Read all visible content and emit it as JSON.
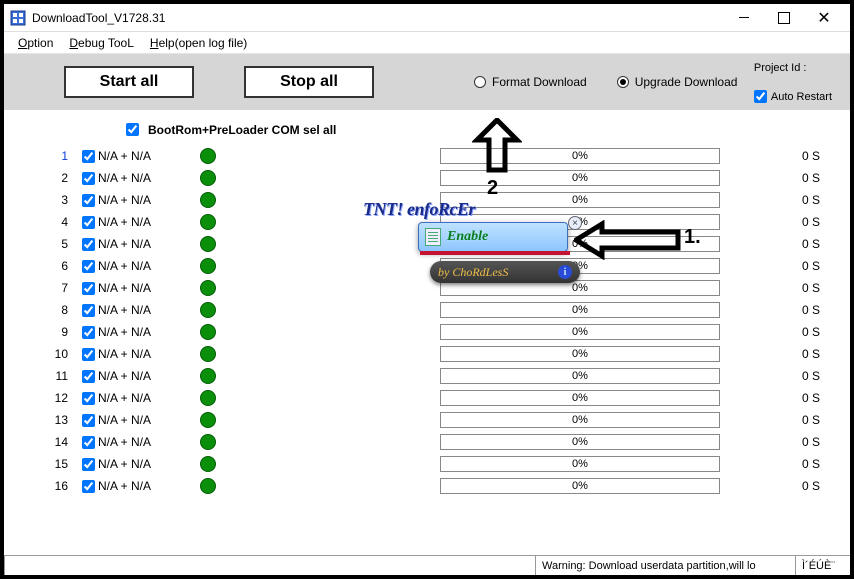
{
  "window": {
    "title": "DownloadTool_V1728.31",
    "minimize": "–",
    "maximize": "□",
    "close": "✕"
  },
  "menu": {
    "option": "Option",
    "debug": "Debug TooL",
    "help": "Help(open log file)"
  },
  "toolbar": {
    "start_all": "Start all",
    "stop_all": "Stop all",
    "format_dl": "Format Download",
    "upgrade_dl": "Upgrade Download"
  },
  "project": {
    "label": "Project Id :",
    "auto_restart": "Auto Restart"
  },
  "sel_all": "BootRom+PreLoader COM sel all",
  "rows": [
    {
      "idx": "1",
      "na": "N/A + N/A",
      "pct": "0%",
      "time": "0 S"
    },
    {
      "idx": "2",
      "na": "N/A + N/A",
      "pct": "0%",
      "time": "0 S"
    },
    {
      "idx": "3",
      "na": "N/A + N/A",
      "pct": "0%",
      "time": "0 S"
    },
    {
      "idx": "4",
      "na": "N/A + N/A",
      "pct": "0%",
      "time": "0 S"
    },
    {
      "idx": "5",
      "na": "N/A + N/A",
      "pct": "0%",
      "time": "0 S"
    },
    {
      "idx": "6",
      "na": "N/A + N/A",
      "pct": "0%",
      "time": "0 S"
    },
    {
      "idx": "7",
      "na": "N/A + N/A",
      "pct": "0%",
      "time": "0 S"
    },
    {
      "idx": "8",
      "na": "N/A + N/A",
      "pct": "0%",
      "time": "0 S"
    },
    {
      "idx": "9",
      "na": "N/A + N/A",
      "pct": "0%",
      "time": "0 S"
    },
    {
      "idx": "10",
      "na": "N/A + N/A",
      "pct": "0%",
      "time": "0 S"
    },
    {
      "idx": "11",
      "na": "N/A + N/A",
      "pct": "0%",
      "time": "0 S"
    },
    {
      "idx": "12",
      "na": "N/A + N/A",
      "pct": "0%",
      "time": "0 S"
    },
    {
      "idx": "13",
      "na": "N/A + N/A",
      "pct": "0%",
      "time": "0 S"
    },
    {
      "idx": "14",
      "na": "N/A + N/A",
      "pct": "0%",
      "time": "0 S"
    },
    {
      "idx": "15",
      "na": "N/A + N/A",
      "pct": "0%",
      "time": "0 S"
    },
    {
      "idx": "16",
      "na": "N/A + N/A",
      "pct": "0%",
      "time": "0 S"
    }
  ],
  "status": {
    "warning": "Warning: Download userdata partition,will lo",
    "tail": "Ì´ÉÚÈ¨"
  },
  "overlay": {
    "step1": "1.",
    "step2": "2",
    "tnt": "TNT! enfoRcEr",
    "enable": "Enable",
    "by": "by ChoRdLesS",
    "close": "×"
  }
}
